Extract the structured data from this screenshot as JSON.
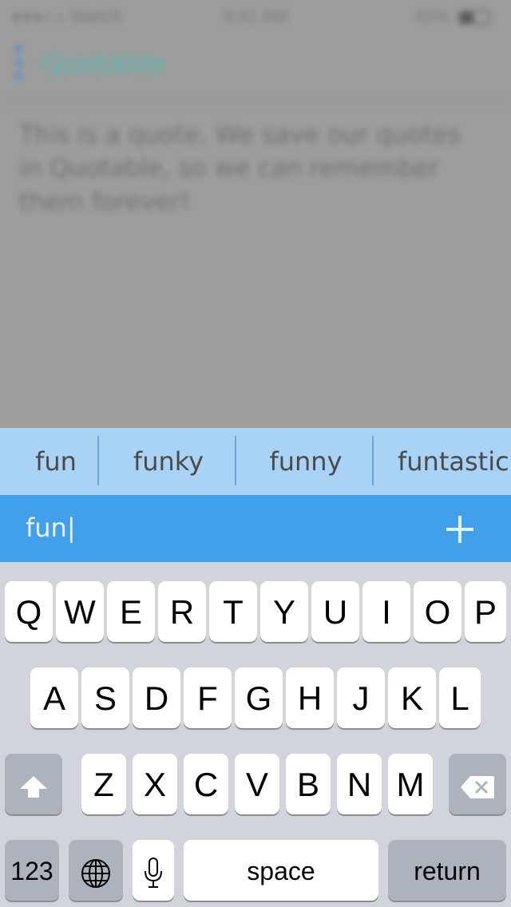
{
  "status_bar": {
    "carrier": "●●●○○ Sketch",
    "time": "9:41 AM",
    "battery": "42%"
  },
  "app": {
    "title": "Quotable",
    "quote": "This is a quote. We save our quotes in Quotable, so we can remember them forever!"
  },
  "suggestions": [
    "fun",
    "funky",
    "funny",
    "funtastic"
  ],
  "input": {
    "value": "fun|"
  },
  "keyboard": {
    "row1": [
      "Q",
      "W",
      "E",
      "R",
      "T",
      "Y",
      "U",
      "I",
      "O",
      "P"
    ],
    "row2": [
      "A",
      "S",
      "D",
      "F",
      "G",
      "H",
      "J",
      "K",
      "L"
    ],
    "row3": [
      "Z",
      "X",
      "C",
      "V",
      "B",
      "N",
      "M"
    ],
    "numbers_label": "123",
    "space_label": "space",
    "return_label": "return"
  },
  "colors": {
    "suggestion_bar": "#a9d3f4",
    "input_bar": "#429fe9",
    "title_accent": "#58b9b2"
  }
}
